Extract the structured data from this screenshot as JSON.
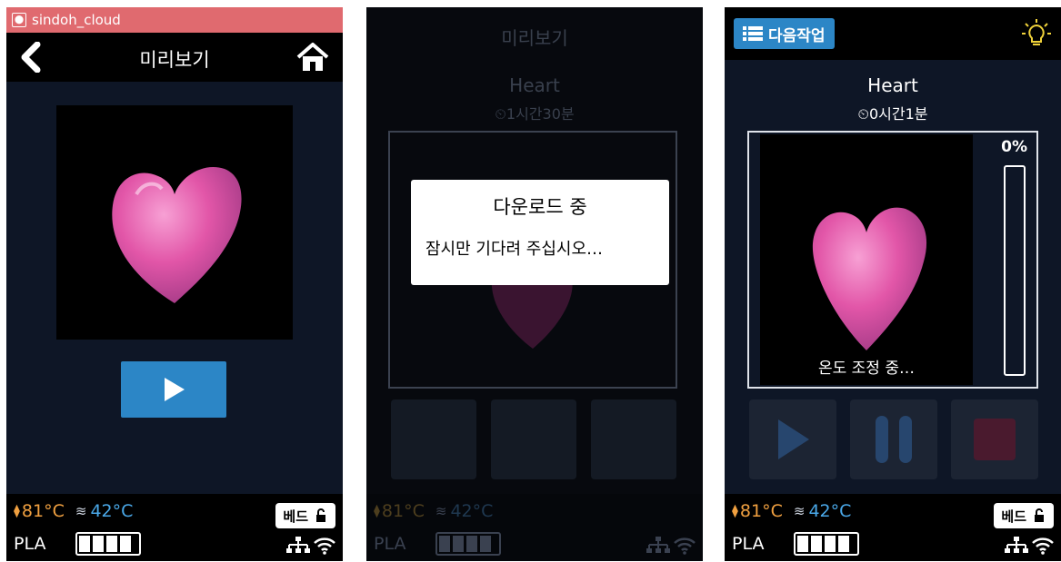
{
  "screen1": {
    "app_name": "sindoh_cloud",
    "title": "미리보기"
  },
  "screen2": {
    "title": "미리보기",
    "model_name": "Heart",
    "print_time": "1시간30분",
    "dialog_title": "다운로드 중",
    "dialog_message": "잠시만 기다려 주십시오…"
  },
  "screen3": {
    "next_job_label": "다음작업",
    "model_name": "Heart",
    "print_time": "0시간1분",
    "status_text": "온도 조정 중…",
    "progress_label": "0%",
    "progress": 0
  },
  "status": {
    "nozzle_temp": "81°C",
    "bed_temp": "42°C",
    "bed_label": "베드",
    "material": "PLA",
    "battery_bars": 4
  },
  "colors": {
    "accent": "#2c86c6",
    "appbar": "#e06a6f",
    "nozzle": "#f0a040",
    "bed": "#4aa8e8"
  }
}
